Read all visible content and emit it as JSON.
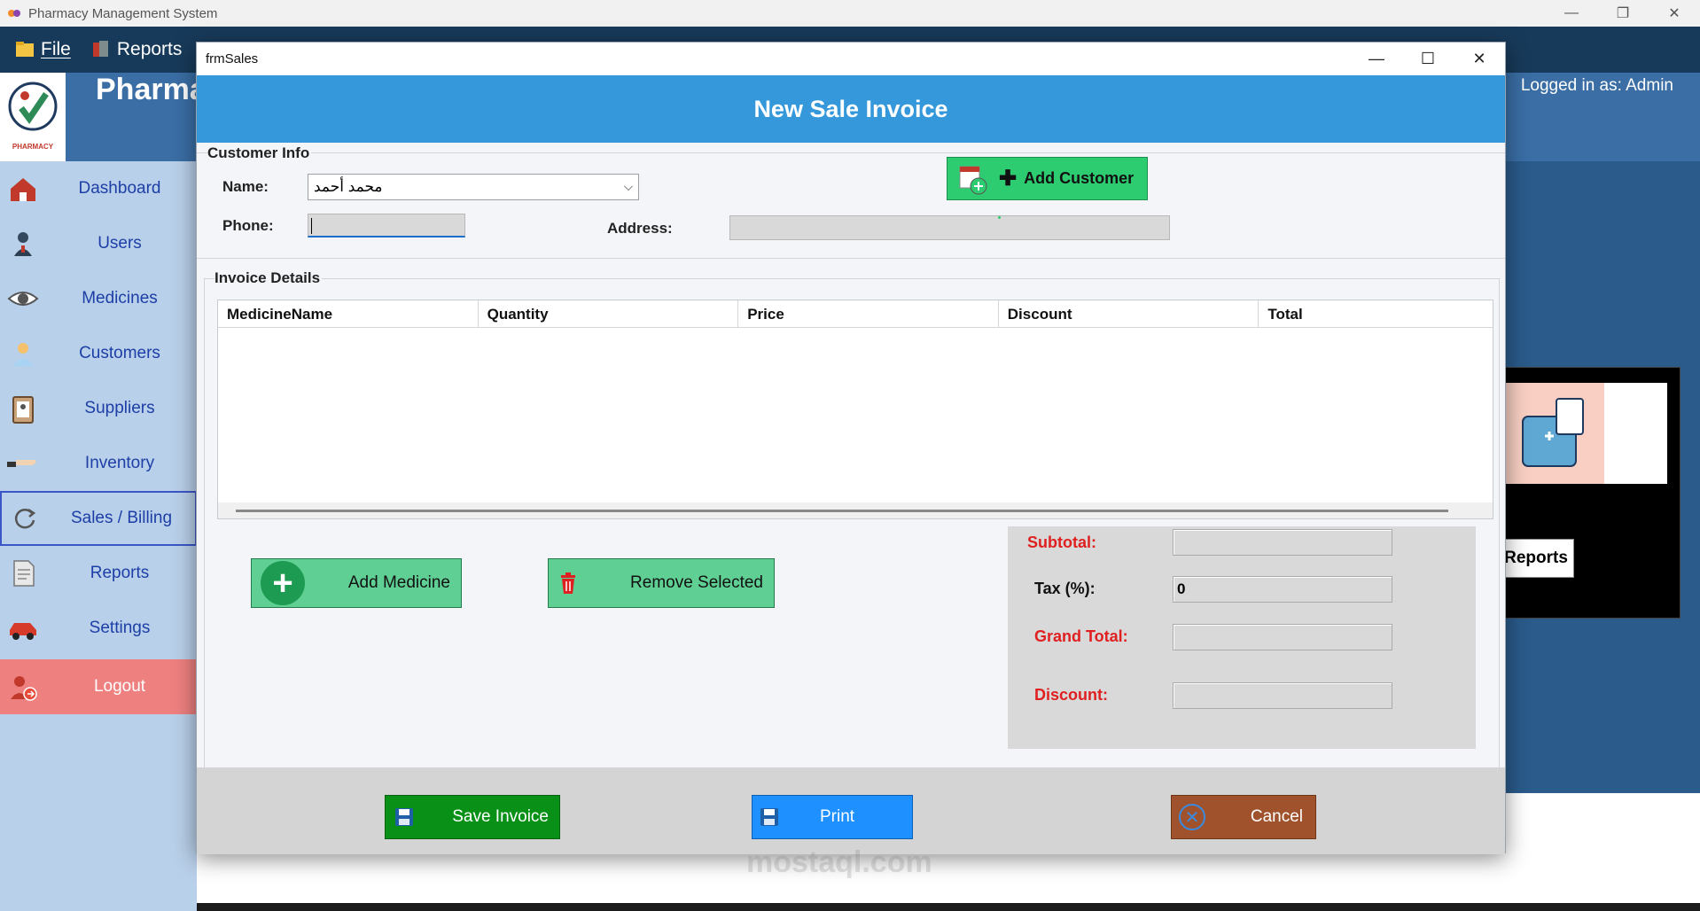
{
  "app": {
    "title": "Pharmacy Management System",
    "window_controls": {
      "minimize": "—",
      "restore": "❐",
      "close": "✕"
    }
  },
  "menubar": {
    "file_label": "File",
    "reports_label": "Reports"
  },
  "header": {
    "brand": "Pharma",
    "logged_in": "Logged in as: Admin",
    "logo_text": "PHARMACY"
  },
  "sidebar": {
    "items": [
      {
        "label": "Dashboard",
        "icon": "house-icon"
      },
      {
        "label": "Users",
        "icon": "user-icon"
      },
      {
        "label": "Medicines",
        "icon": "eye-icon"
      },
      {
        "label": "Customers",
        "icon": "person-icon"
      },
      {
        "label": "Suppliers",
        "icon": "clipboard-icon"
      },
      {
        "label": "Inventory",
        "icon": "hand-icon"
      },
      {
        "label": "Sales / Billing",
        "icon": "refresh-icon"
      },
      {
        "label": "Reports",
        "icon": "document-icon"
      },
      {
        "label": "Settings",
        "icon": "car-icon"
      },
      {
        "label": "Logout",
        "icon": "logout-icon"
      }
    ],
    "active": "Sales / Billing"
  },
  "background_panel": {
    "reports_button": "Reports"
  },
  "dialog": {
    "title": "frmSales",
    "header": "New Sale Invoice",
    "customer_info": {
      "group_label": "Customer Info",
      "name_label": "Name:",
      "name_value": "محمد أحمد",
      "phone_label": "Phone:",
      "phone_value": "",
      "address_label": "Address:",
      "address_value": "",
      "add_customer_label": "Add Customer"
    },
    "invoice_details": {
      "group_label": "Invoice Details",
      "columns": [
        "MedicineName",
        "Quantity",
        "Price",
        "Discount",
        "Total"
      ],
      "rows": []
    },
    "buttons": {
      "add_medicine": "Add Medicine",
      "remove_selected": "Remove Selected",
      "save_invoice": "Save Invoice",
      "print": "Print",
      "cancel": "Cancel"
    },
    "totals": {
      "subtotal_label": "Subtotal:",
      "subtotal_value": "",
      "tax_label": "Tax  (%):",
      "tax_value": "0",
      "grand_total_label": "Grand Total:",
      "grand_total_value": "",
      "discount_label": "Discount:",
      "discount_value": ""
    }
  },
  "watermark": "mostaql.com",
  "colors": {
    "header_blue": "#3498db",
    "add_button_green": "#2ecc71",
    "save_green": "#089017",
    "print_blue": "#1e90ff",
    "cancel_brown": "#a0522d",
    "logout_red": "#ef8080",
    "label_red": "#e02020"
  }
}
